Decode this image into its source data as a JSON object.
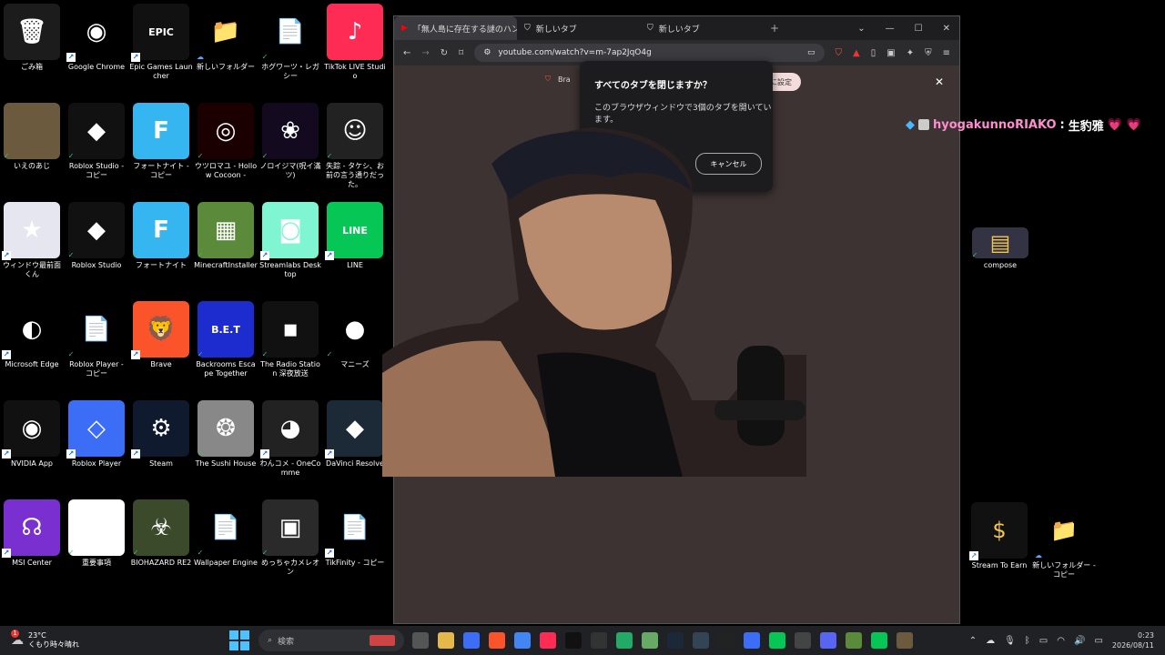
{
  "desktop": {
    "icons": [
      {
        "label": "ごみ箱",
        "icon": "recycle-bin-icon",
        "bg": "#1c1c1c",
        "glyph": "🗑",
        "badge": ""
      },
      {
        "label": "Google Chrome",
        "icon": "chrome-icon",
        "bg": "#000",
        "glyph": "◉",
        "badge": "arrow"
      },
      {
        "label": "Epic Games Launcher",
        "icon": "epic-games-icon",
        "bg": "#111",
        "glyph": "EPIC",
        "badge": "arrow"
      },
      {
        "label": "新しいフォルダー",
        "icon": "folder-icon",
        "bg": "#000",
        "glyph": "📁",
        "badge": "cloud"
      },
      {
        "label": "ホグワーツ・レガシー",
        "icon": "file-icon",
        "bg": "#000",
        "glyph": "📄",
        "badge": "check"
      },
      {
        "label": "TikTok LIVE Studio",
        "icon": "tiktok-live-icon",
        "bg": "#fe2c55",
        "glyph": "♪",
        "badge": ""
      },
      {
        "label": "いえのあじ",
        "icon": "photo-icon",
        "bg": "#6b5a3e",
        "glyph": "",
        "badge": "check"
      },
      {
        "label": "Roblox Studio - コピー",
        "icon": "roblox-studio-icon",
        "bg": "#111",
        "glyph": "◆",
        "badge": "check"
      },
      {
        "label": "フォートナイト - コピー",
        "icon": "fortnite-icon",
        "bg": "#36b6f0",
        "glyph": "F",
        "badge": "check"
      },
      {
        "label": "ウツロマユ - Hollow Cocoon -",
        "icon": "game-icon",
        "bg": "#1a0000",
        "glyph": "◎",
        "badge": "check"
      },
      {
        "label": "ノロイジマ(呪イ滿ツ)",
        "icon": "game-icon",
        "bg": "#140a1f",
        "glyph": "❀",
        "badge": "check"
      },
      {
        "label": "失踪 - タケシ、お前の言う通りだった。",
        "icon": "game-icon",
        "bg": "#222",
        "glyph": "☺",
        "badge": "check"
      },
      {
        "label": "ウィンドウ最前面くん",
        "icon": "pin-window-icon",
        "bg": "#e6e6f0",
        "glyph": "★",
        "badge": "arrow"
      },
      {
        "label": "Roblox Studio",
        "icon": "roblox-studio-icon",
        "bg": "#111",
        "glyph": "◆",
        "badge": "check"
      },
      {
        "label": "フォートナイト",
        "icon": "fortnite-icon",
        "bg": "#36b6f0",
        "glyph": "F",
        "badge": "check"
      },
      {
        "label": "MinecraftInstaller",
        "icon": "minecraft-icon",
        "bg": "#5a8a3a",
        "glyph": "▦",
        "badge": "check"
      },
      {
        "label": "Streamlabs Desktop",
        "icon": "streamlabs-icon",
        "bg": "#80f5d2",
        "glyph": "◙",
        "badge": "arrow"
      },
      {
        "label": "LINE",
        "icon": "line-icon",
        "bg": "#06c755",
        "glyph": "LINE",
        "badge": "arrow"
      },
      {
        "label": "Microsoft Edge",
        "icon": "edge-icon",
        "bg": "#000",
        "glyph": "◐",
        "badge": "arrow"
      },
      {
        "label": "Roblox Player - コピー",
        "icon": "file-icon",
        "bg": "#000",
        "glyph": "📄",
        "badge": "check"
      },
      {
        "label": "Brave",
        "icon": "brave-icon",
        "bg": "#fb542b",
        "glyph": "🦁",
        "badge": "arrow"
      },
      {
        "label": "Backrooms Escape Together",
        "icon": "bet-icon",
        "bg": "#1c2ccf",
        "glyph": "B.E.T",
        "badge": "check"
      },
      {
        "label": "The Radio Station 深夜放送",
        "icon": "game-icon",
        "bg": "#111",
        "glyph": "▪",
        "badge": "check"
      },
      {
        "label": "マニーズ",
        "icon": "game-icon",
        "bg": "#000",
        "glyph": "●",
        "badge": "check"
      },
      {
        "label": "NVIDIA App",
        "icon": "nvidia-icon",
        "bg": "#111",
        "glyph": "◉",
        "badge": "arrow"
      },
      {
        "label": "Roblox Player",
        "icon": "roblox-icon",
        "bg": "#3b6df6",
        "glyph": "◇",
        "badge": "arrow"
      },
      {
        "label": "Steam",
        "icon": "steam-icon",
        "bg": "#0f1a2e",
        "glyph": "⚙",
        "badge": "arrow"
      },
      {
        "label": "The Sushi House",
        "icon": "game-icon",
        "bg": "#888",
        "glyph": "❂",
        "badge": "check"
      },
      {
        "label": "わんコメ - OneComme",
        "icon": "onecomme-icon",
        "bg": "#222",
        "glyph": "◕",
        "badge": "arrow"
      },
      {
        "label": "DaVinci Resolve",
        "icon": "davinci-icon",
        "bg": "#1b2a36",
        "glyph": "◆",
        "badge": "arrow"
      },
      {
        "label": "MSI Center",
        "icon": "msi-center-icon",
        "bg": "#7a2fd1",
        "glyph": "☊",
        "badge": "arrow"
      },
      {
        "label": "重要事項",
        "icon": "document-icon",
        "bg": "#fff",
        "glyph": "≡",
        "badge": "check"
      },
      {
        "label": "BIOHAZARD RE2",
        "icon": "game-icon",
        "bg": "#3b4a2a",
        "glyph": "☣",
        "badge": "check"
      },
      {
        "label": "Wallpaper Engine",
        "icon": "file-icon",
        "bg": "#000",
        "glyph": "📄",
        "badge": "check"
      },
      {
        "label": "めっちゃカメレオン",
        "icon": "game-icon",
        "bg": "#2a2a2a",
        "glyph": "▣",
        "badge": "check"
      },
      {
        "label": "TikFinity - コピー",
        "icon": "file-icon",
        "bg": "#000",
        "glyph": "📄",
        "badge": "arrow"
      }
    ],
    "right_icons": [
      {
        "label": "compose",
        "icon": "compose-icon",
        "bg": "#334",
        "glyph": "▤",
        "badge": "check"
      },
      {
        "label": "Stream To Earn",
        "icon": "stream-to-earn-icon",
        "bg": "#111",
        "glyph": "$",
        "badge": "arrow"
      },
      {
        "label": "新しいフォルダー - コピー",
        "icon": "folder-icon",
        "bg": "#000",
        "glyph": "📁",
        "badge": "cloud"
      }
    ]
  },
  "browser": {
    "tabs": [
      {
        "title": "「無人島に存在する謎のハンバー",
        "active": true
      },
      {
        "title": "新しいタブ",
        "active": false
      },
      {
        "title": "新しいタブ",
        "active": false
      }
    ],
    "new_tab": "+",
    "url": "youtube.com/watch?v=m-7ap2JqO4g",
    "brave_bar_text": "Bra",
    "pill_text": "トに設定",
    "dialog": {
      "title": "すべてのタブを閉じますか？",
      "message": "このブラウザウィンドウで3個のタブを開いています。",
      "cancel": "キャンセル"
    }
  },
  "chat_overlay": {
    "user": "hyogakunnoRIAKO",
    "separator": ":",
    "message": "生豹雅",
    "hearts": "💗 💗"
  },
  "taskbar": {
    "weather_temp": "23°C",
    "weather_desc": "くもり時々晴れ",
    "weather_badge": "1",
    "search_placeholder": "検索",
    "time": "0:23",
    "date": "2026/08/11",
    "apps": [
      {
        "icon": "task-view-icon",
        "bg": "#555"
      },
      {
        "icon": "file-explorer-icon",
        "bg": "#e6b84a"
      },
      {
        "icon": "roblox-studio-icon",
        "bg": "#3b6df6"
      },
      {
        "icon": "brave-icon",
        "bg": "#fb542b"
      },
      {
        "icon": "chrome-icon",
        "bg": "#4285f4"
      },
      {
        "icon": "tiktok-icon",
        "bg": "#fe2c55"
      },
      {
        "icon": "tiktok-icon",
        "bg": "#111"
      },
      {
        "icon": "terminal-icon",
        "bg": "#333"
      },
      {
        "icon": "app-icon",
        "bg": "#2a6"
      },
      {
        "icon": "app-icon",
        "bg": "#6a6"
      },
      {
        "icon": "steam-icon",
        "bg": "#1b2838"
      },
      {
        "icon": "davinci-icon",
        "bg": "#345"
      },
      {
        "icon": "obs-icon",
        "bg": "#222"
      },
      {
        "icon": "pin-window-icon",
        "bg": "#3b6df6"
      },
      {
        "icon": "line-icon",
        "bg": "#06c755"
      },
      {
        "icon": "game-icon",
        "bg": "#444"
      },
      {
        "icon": "discord-icon",
        "bg": "#5865f2"
      },
      {
        "icon": "minecraft-icon",
        "bg": "#5a8a3a"
      },
      {
        "icon": "line-icon",
        "bg": "#06c755"
      },
      {
        "icon": "game-icon",
        "bg": "#6b5a3e"
      }
    ]
  }
}
